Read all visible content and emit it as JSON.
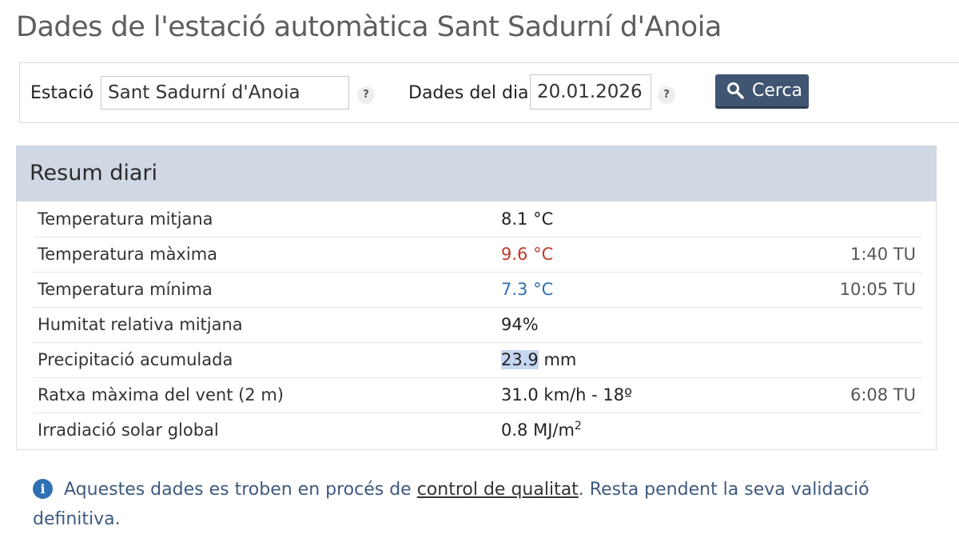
{
  "page": {
    "title": "Dades de l'estació automàtica Sant Sadurní d'Anoia"
  },
  "search": {
    "station_label": "Estació",
    "station_value": "Sant Sadurní d'Anoia",
    "date_label": "Dades del dia",
    "date_value": "20.01.2026",
    "help_glyph": "?",
    "button_label": "Cerca",
    "button_icon": "search-icon"
  },
  "summary": {
    "title": "Resum diari",
    "rows": [
      {
        "name": "Temperatura mitjana",
        "value": "8.1 °C",
        "time": ""
      },
      {
        "name": "Temperatura màxima",
        "value": "9.6 °C",
        "time": "1:40 TU"
      },
      {
        "name": "Temperatura mínima",
        "value": "7.3 °C",
        "time": "10:05 TU"
      },
      {
        "name": "Humitat relativa mitjana",
        "value": "94%",
        "time": ""
      },
      {
        "name": "Precipitació acumulada",
        "value_number": "23.9",
        "value_unit": " mm",
        "time": ""
      },
      {
        "name": "Ratxa màxima del vent (2 m)",
        "value": "31.0 km/h - 18º",
        "time": "6:08 TU"
      },
      {
        "name": "Irradiació solar global",
        "value_prefix": "0.8 MJ/m",
        "value_sup": "2",
        "time": ""
      }
    ]
  },
  "notice": {
    "icon": "info-icon",
    "icon_glyph": "i",
    "text_before": "Aquestes dades es troben en procés de ",
    "link_text": "control de qualitat",
    "text_after": ". Resta pendent la seva validació definitiva."
  },
  "colors": {
    "max_temp": "#c0392b",
    "min_temp": "#2f6fb3",
    "header_bg": "#cfd8e3",
    "button_bg": "#3f5571"
  }
}
